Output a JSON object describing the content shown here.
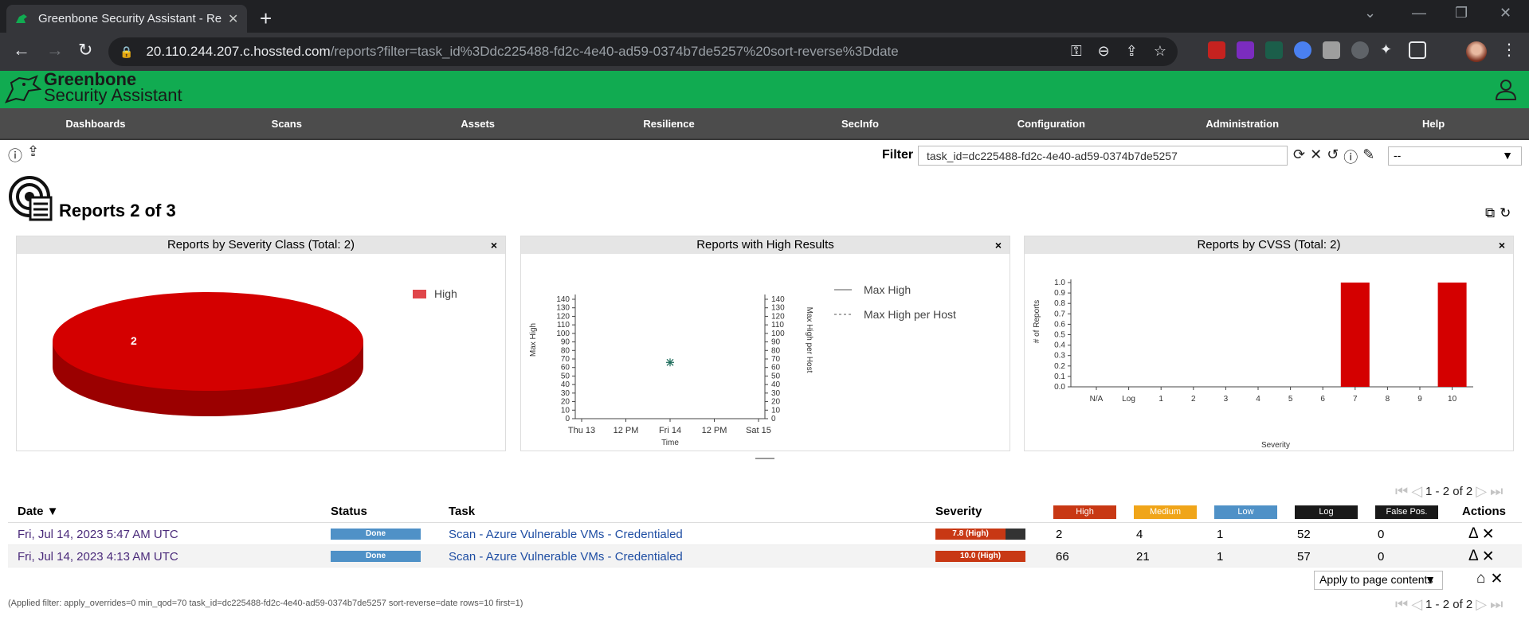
{
  "browser": {
    "tab_title": "Greenbone Security Assistant - Reports",
    "url_host": "20.110.244.207.c.hossted.com",
    "url_path": "/reports?filter=task_id%3Ddc225488-fd2c-4e40-ad59-0374b7de5257%20sort-reverse%3Ddate"
  },
  "app": {
    "logo_line1": "Greenbone",
    "logo_line2": "Security Assistant",
    "brand_color": "#11ab51"
  },
  "nav": [
    "Dashboards",
    "Scans",
    "Assets",
    "Resilience",
    "SecInfo",
    "Configuration",
    "Administration",
    "Help"
  ],
  "filter": {
    "label": "Filter",
    "value": "task_id=dc225488-fd2c-4e40-ad59-0374b7de5257",
    "select_value": "--"
  },
  "page": {
    "title": "Reports 2 of 3"
  },
  "panels": {
    "severity_class": {
      "title": "Reports by Severity Class (Total: 2)",
      "close": "×"
    },
    "high_results": {
      "title": "Reports with High Results",
      "close": "×"
    },
    "cvss": {
      "title": "Reports by CVSS (Total: 2)",
      "close": "×"
    }
  },
  "chart_data": [
    {
      "type": "pie",
      "title": "Reports by Severity Class (Total: 2)",
      "slices": [
        {
          "label": "High",
          "value": 2,
          "color": "#d40000"
        }
      ],
      "legend": [
        "High"
      ],
      "legend_position": "top-right"
    },
    {
      "type": "line",
      "title": "Reports with High Results",
      "xlabel": "Time",
      "ylabel": "Max High",
      "y2label": "Max High per Host",
      "x_ticks": [
        "Thu 13",
        "12 PM",
        "Fri 14",
        "12 PM",
        "Sat 15"
      ],
      "y_ticks": [
        0,
        10,
        20,
        30,
        40,
        50,
        60,
        70,
        80,
        90,
        100,
        110,
        120,
        130,
        140
      ],
      "ylim": [
        0,
        140
      ],
      "series": [
        {
          "name": "Max High",
          "style": "solid",
          "points": [
            {
              "x": "Fri 14",
              "y": 66
            }
          ]
        },
        {
          "name": "Max High per Host",
          "style": "dashed",
          "points": [
            {
              "x": "Fri 14",
              "y": 66
            }
          ]
        }
      ],
      "legend_position": "top-right"
    },
    {
      "type": "bar",
      "title": "Reports by CVSS (Total: 2)",
      "xlabel": "Severity",
      "ylabel": "# of Reports",
      "categories": [
        "N/A",
        "Log",
        "1",
        "2",
        "3",
        "4",
        "5",
        "6",
        "7",
        "8",
        "9",
        "10"
      ],
      "values": [
        0,
        0,
        0,
        0,
        0,
        0,
        0,
        0,
        1,
        0,
        0,
        1
      ],
      "y_ticks": [
        "0.0",
        "0.1",
        "0.2",
        "0.3",
        "0.4",
        "0.5",
        "0.6",
        "0.7",
        "0.8",
        "0.9",
        "1.0"
      ],
      "ylim": [
        0,
        1.0
      ]
    }
  ],
  "pagination": {
    "text": "1 - 2 of 2"
  },
  "table": {
    "headers": {
      "date": "Date ▼",
      "status": "Status",
      "task": "Task",
      "severity": "Severity",
      "high": "High",
      "medium": "Medium",
      "low": "Low",
      "log": "Log",
      "false_pos": "False Pos.",
      "actions": "Actions"
    },
    "header_colors": {
      "high": "#c83814",
      "medium": "#f0a519",
      "low": "#4f91c7",
      "log": "#191919",
      "false_pos": "#191919"
    },
    "rows": [
      {
        "date": "Fri, Jul 14, 2023 5:47 AM UTC",
        "status": "Done",
        "task": "Scan - Azure Vulnerable VMs - Credentialed",
        "severity": "7.8 (High)",
        "severity_fraction": 0.78,
        "high": "2",
        "medium": "4",
        "low": "1",
        "log": "52",
        "false_pos": "0"
      },
      {
        "date": "Fri, Jul 14, 2023 4:13 AM UTC",
        "status": "Done",
        "task": "Scan - Azure Vulnerable VMs - Credentialed",
        "severity": "10.0 (High)",
        "severity_fraction": 1.0,
        "high": "66",
        "medium": "21",
        "low": "1",
        "log": "57",
        "false_pos": "0"
      }
    ]
  },
  "bulk": {
    "apply_label": "Apply to page contents"
  },
  "applied_filter": "(Applied filter: apply_overrides=0 min_qod=70 task_id=dc225488-fd2c-4e40-ad59-0374b7de5257 sort-reverse=date rows=10 first=1)"
}
